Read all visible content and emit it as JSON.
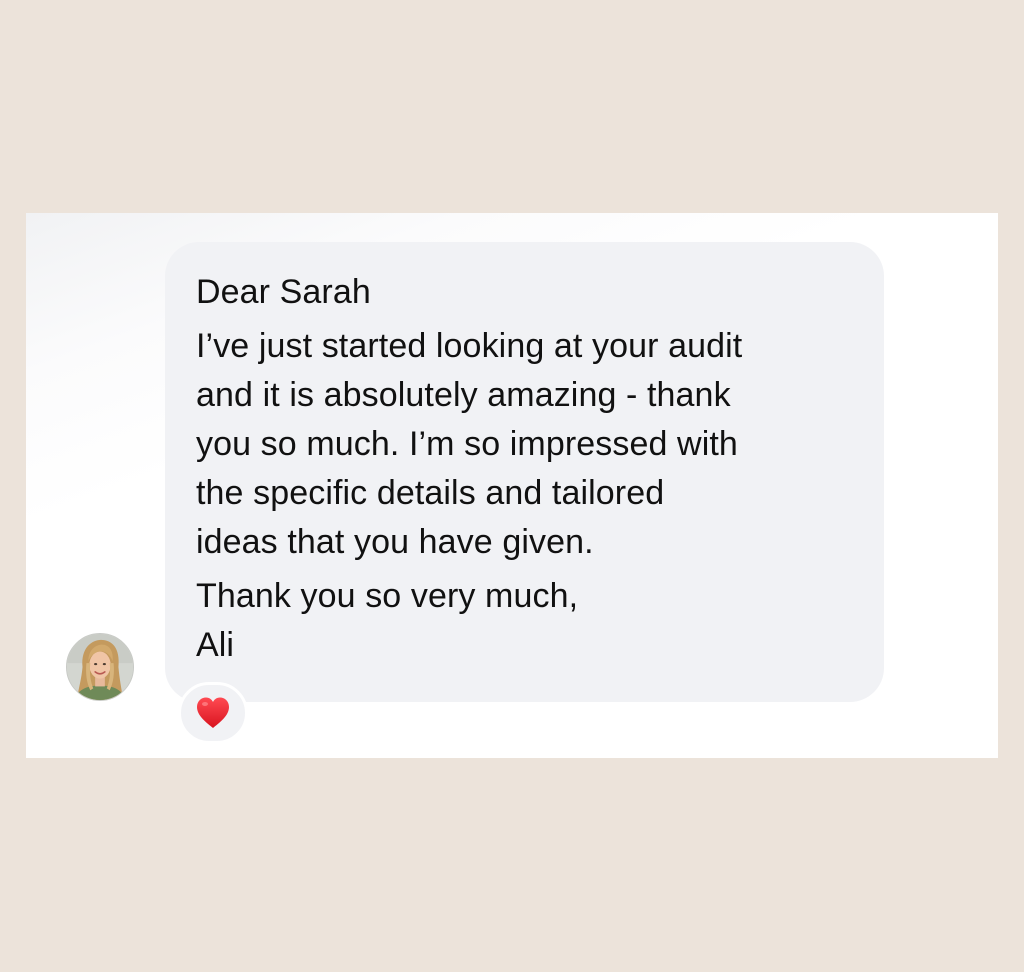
{
  "message": {
    "greeting": "Dear Sarah",
    "body_lines": [
      "I’ve just started looking at your audit",
      "and it is absolutely amazing - thank",
      "you so much. I’m so impressed with",
      "the specific details and tailored",
      "ideas that you have given."
    ],
    "closing": "Thank you so very much,",
    "signature": "Ali"
  },
  "sender": {
    "avatar_icon": "user-photo-avatar"
  },
  "reaction": {
    "icon": "red-heart-icon",
    "color": "#e3232c"
  },
  "colors": {
    "page_background": "#ece3da",
    "card_background": "#ffffff",
    "bubble_background": "#f1f2f5",
    "text": "#111111"
  }
}
